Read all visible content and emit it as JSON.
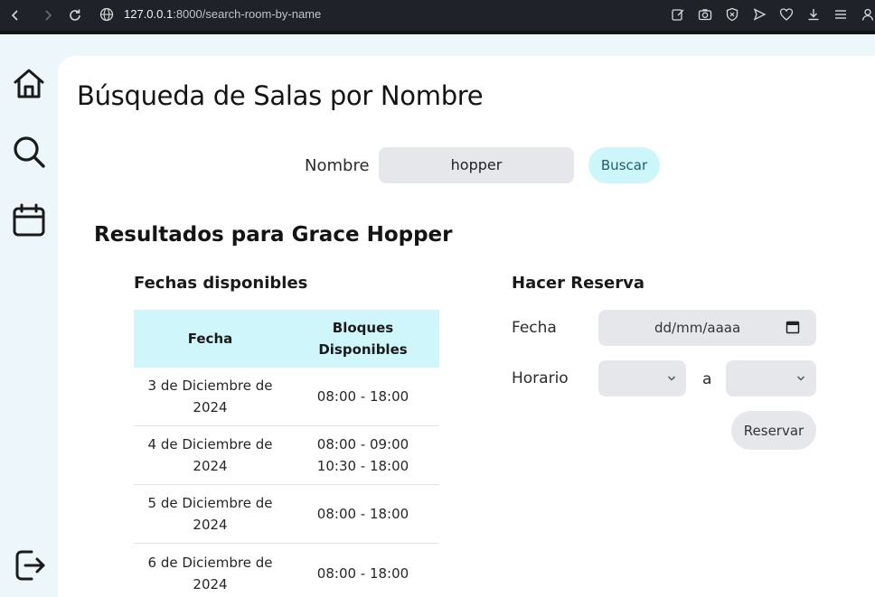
{
  "browser": {
    "url_host": "127.0.0.1",
    "url_rest": ":8000/search-room-by-name"
  },
  "sidebar": {
    "items": [
      {
        "icon": "home-icon"
      },
      {
        "icon": "search-icon"
      },
      {
        "icon": "calendar-icon"
      },
      {
        "icon": "logout-icon"
      }
    ]
  },
  "page": {
    "title": "Búsqueda de Salas por Nombre"
  },
  "search": {
    "label": "Nombre",
    "value": "hopper",
    "button": "Buscar"
  },
  "results": {
    "title": "Resultados para Grace Hopper",
    "dates_title": "Fechas disponibles",
    "columns": [
      "Fecha",
      "Bloques Disponibles"
    ],
    "rows": [
      {
        "fecha": "3 de Diciembre de 2024",
        "bloques": [
          "08:00 - 18:00"
        ]
      },
      {
        "fecha": "4 de Diciembre de 2024",
        "bloques": [
          "08:00 - 09:00",
          "10:30 - 18:00"
        ]
      },
      {
        "fecha": "5 de Diciembre de 2024",
        "bloques": [
          "08:00 - 18:00"
        ]
      },
      {
        "fecha": "6 de Diciembre de 2024",
        "bloques": [
          "08:00 - 18:00"
        ]
      }
    ]
  },
  "reservation": {
    "title": "Hacer Reserva",
    "fecha_label": "Fecha",
    "date_placeholder": "dd/mm/aaaa",
    "horario_label": "Horario",
    "separator": "a",
    "button": "Reservar"
  },
  "colors": {
    "accent_button": "#cdf6fa",
    "table_header": "#cff6fb",
    "input_bg": "#e6e7ea",
    "sidebar_bg": "#ecf6fb"
  }
}
